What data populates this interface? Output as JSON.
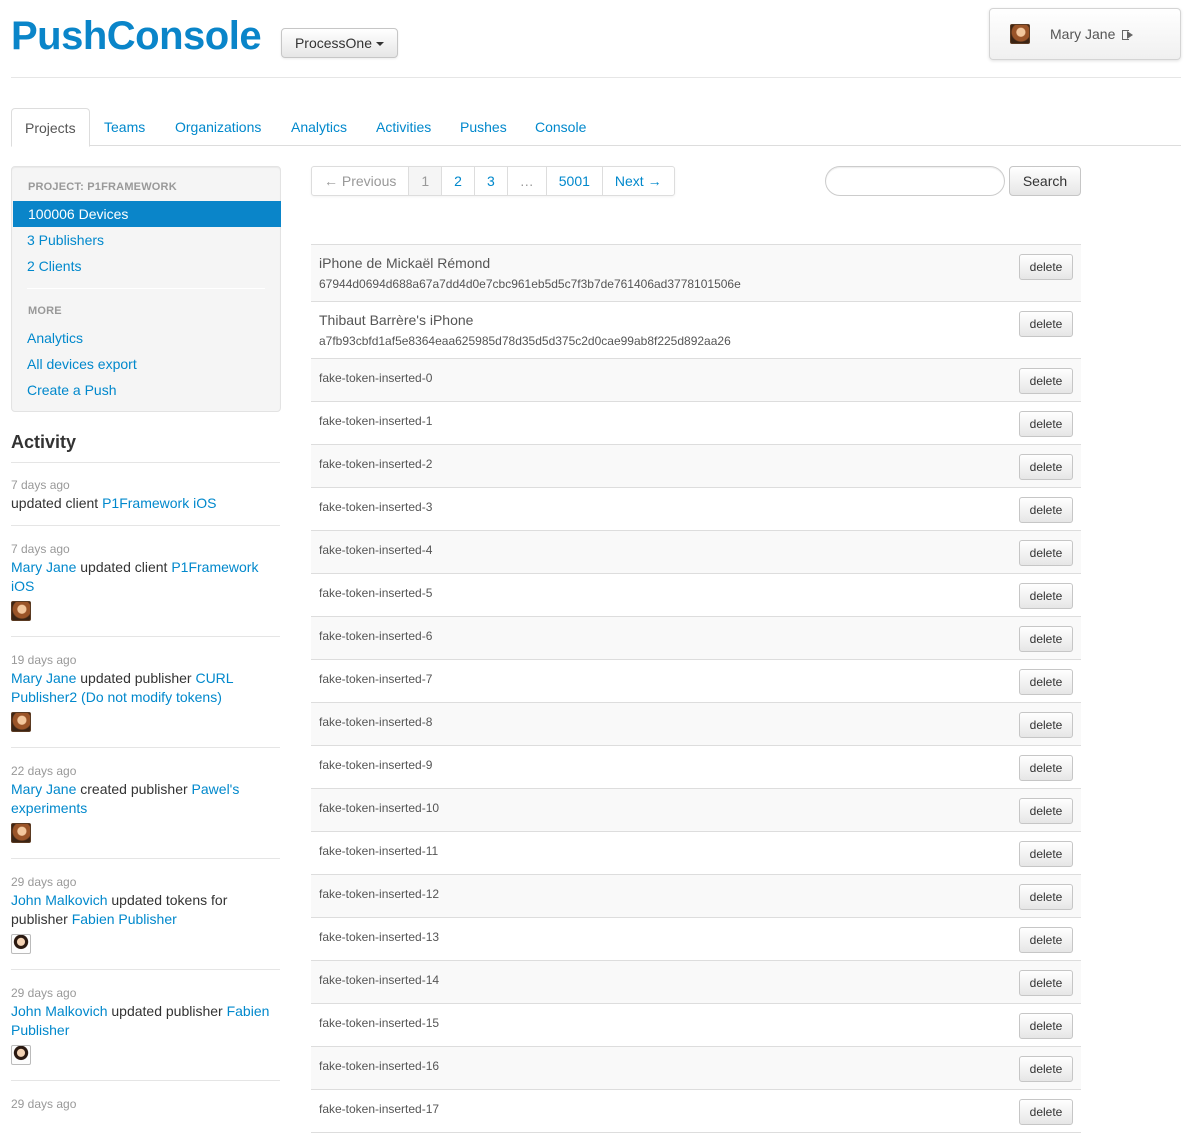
{
  "brand": "PushConsole",
  "org_selector": "ProcessOne",
  "user": {
    "name": "Mary Jane"
  },
  "tabs": [
    "Projects",
    "Teams",
    "Organizations",
    "Analytics",
    "Activities",
    "Pushes",
    "Console"
  ],
  "sidebar": {
    "project_header": "PROJECT: P1FRAMEWORK",
    "items": [
      "100006 Devices",
      "3 Publishers",
      "2 Clients"
    ],
    "more_header": "MORE",
    "more_items": [
      "Analytics",
      "All devices export",
      "Create a Push"
    ]
  },
  "activity": {
    "title": "Activity",
    "entries": [
      {
        "when": "7 days ago",
        "actor": "",
        "action": "updated client ",
        "target": "P1Framework iOS"
      },
      {
        "when": "7 days ago",
        "actor": "Mary Jane",
        "action": " updated client ",
        "target": "P1Framework iOS"
      },
      {
        "when": "19 days ago",
        "actor": "Mary Jane",
        "action": " updated publisher ",
        "target": "CURL Publisher2 (Do not modify tokens)"
      },
      {
        "when": "22 days ago",
        "actor": "Mary Jane",
        "action": " created publisher ",
        "target": "Pawel's experiments"
      },
      {
        "when": "29 days ago",
        "actor": "John Malkovich",
        "action": " updated tokens for publisher ",
        "target": "Fabien Publisher"
      },
      {
        "when": "29 days ago",
        "actor": "John Malkovich",
        "action": " updated publisher ",
        "target": "Fabien Publisher"
      },
      {
        "when": "29 days ago",
        "actor": "",
        "action": "",
        "target": ""
      }
    ]
  },
  "pagination": {
    "previous": "← Previous",
    "pages": [
      "1",
      "2",
      "3",
      "…",
      "5001"
    ],
    "next": "Next →"
  },
  "search": {
    "placeholder": "",
    "button": "Search"
  },
  "devices": {
    "delete_label": "delete",
    "named": [
      {
        "name": "iPhone de Mickaël Rémond",
        "token": "67944d0694d688a67a7dd4d0e7cbc961eb5d5c7f3b7de761406ad3778101506e"
      },
      {
        "name": "Thibaut Barrère's iPhone",
        "token": "a7fb93cbfd1af5e8364eaa625985d78d35d5d375c2d0cae99ab8f225d892aa26"
      }
    ],
    "fake": [
      "fake-token-inserted-0",
      "fake-token-inserted-1",
      "fake-token-inserted-2",
      "fake-token-inserted-3",
      "fake-token-inserted-4",
      "fake-token-inserted-5",
      "fake-token-inserted-6",
      "fake-token-inserted-7",
      "fake-token-inserted-8",
      "fake-token-inserted-9",
      "fake-token-inserted-10",
      "fake-token-inserted-11",
      "fake-token-inserted-12",
      "fake-token-inserted-13",
      "fake-token-inserted-14",
      "fake-token-inserted-15",
      "fake-token-inserted-16",
      "fake-token-inserted-17"
    ]
  }
}
